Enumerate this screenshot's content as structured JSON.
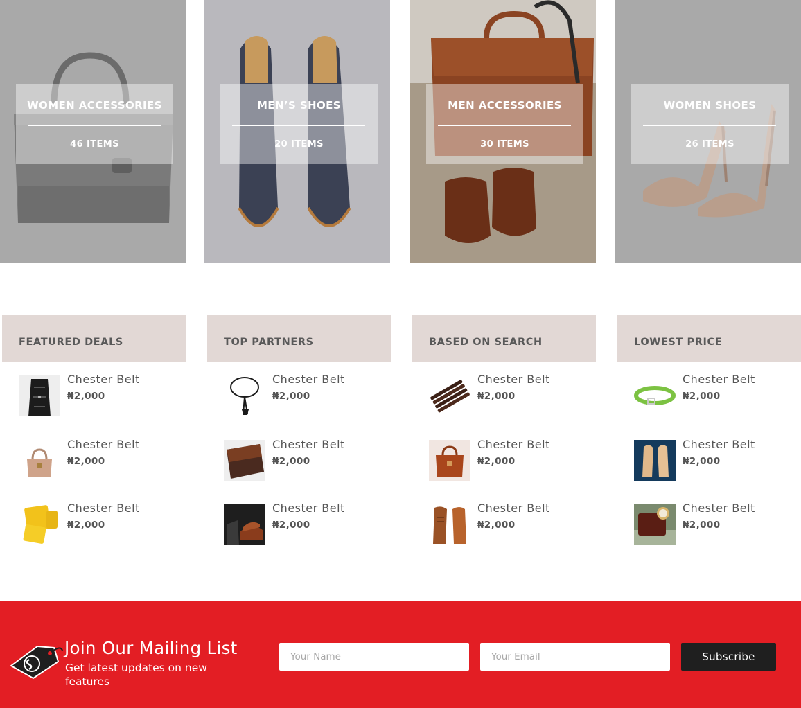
{
  "categories": [
    {
      "title": "WOMEN ACCESSORIES",
      "count": "46 ITEMS",
      "image": "handbag-image"
    },
    {
      "title": "MEN’S SHOES",
      "count": "20 ITEMS",
      "image": "suede-shoes-image"
    },
    {
      "title": "MEN ACCESSORIES",
      "count": "30 ITEMS",
      "image": "briefcase-image"
    },
    {
      "title": "WOMEN SHOES",
      "count": "26 ITEMS",
      "image": "heels-image"
    }
  ],
  "columns": [
    {
      "heading": "FEATURED DEALS",
      "items": [
        {
          "name": "Chester Belt",
          "price": "₦2,000",
          "thumb": "harness-icon"
        },
        {
          "name": "Chester Belt",
          "price": "₦2,000",
          "thumb": "handbag-icon"
        },
        {
          "name": "Chester Belt",
          "price": "₦2,000",
          "thumb": "wallet-icon"
        }
      ]
    },
    {
      "heading": "TOP PARTNERS",
      "items": [
        {
          "name": "Chester Belt",
          "price": "₦2,000",
          "thumb": "choker-icon"
        },
        {
          "name": "Chester Belt",
          "price": "₦2,000",
          "thumb": "clutch-icon"
        },
        {
          "name": "Chester Belt",
          "price": "₦2,000",
          "thumb": "brogues-icon"
        }
      ]
    },
    {
      "heading": "BASED ON SEARCH",
      "items": [
        {
          "name": "Chester Belt",
          "price": "₦2,000",
          "thumb": "bracelets-icon"
        },
        {
          "name": "Chester Belt",
          "price": "₦2,000",
          "thumb": "satchel-icon"
        },
        {
          "name": "Chester Belt",
          "price": "₦2,000",
          "thumb": "oxfords-icon"
        }
      ]
    },
    {
      "heading": "LOWEST PRICE",
      "items": [
        {
          "name": "Chester Belt",
          "price": "₦2,000",
          "thumb": "belt-icon"
        },
        {
          "name": "Chester Belt",
          "price": "₦2,000",
          "thumb": "loafers-icon"
        },
        {
          "name": "Chester Belt",
          "price": "₦2,000",
          "thumb": "watch-icon"
        }
      ]
    }
  ],
  "mailing": {
    "title": "Join Our Mailing List",
    "subtitle": "Get latest updates on new features",
    "name_placeholder": "Your Name",
    "email_placeholder": "Your Email",
    "button": "Subscribe",
    "logo": "price-tag-logo-icon"
  },
  "colors": {
    "accent": "#e31e24",
    "header_bg": "#e2d8d5",
    "button_bg": "#1f1f1f"
  }
}
